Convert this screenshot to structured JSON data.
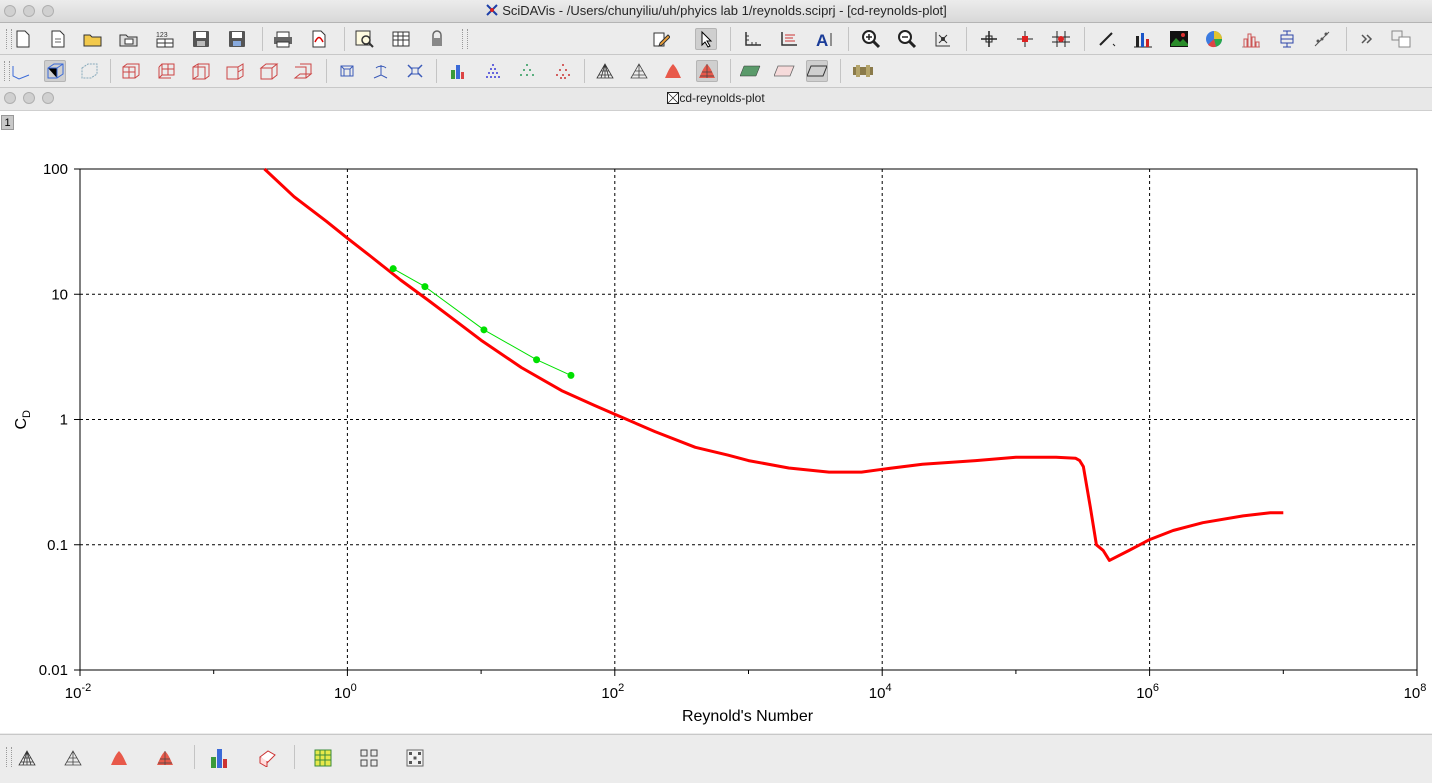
{
  "window": {
    "title": "SciDAVis - /Users/chunyiliu/uh/phyics lab 1/reynolds.sciprj - [cd-reynolds-plot]"
  },
  "subwindow": {
    "title": "cd-reynolds-plot",
    "layer_label": "1"
  },
  "toolbar1": {
    "buttons": [
      "new-project-icon",
      "new-file-icon",
      "open-folder-icon",
      "open-template-icon",
      "import-ascii-icon",
      "save-icon",
      "save-as-icon",
      "print-icon",
      "export-pdf-icon",
      "find-icon",
      "table-icon",
      "lock-icon",
      "edit-icon",
      "pointer-icon",
      "axes-icon",
      "legend-icon",
      "text-icon",
      "zoom-in-icon",
      "zoom-out-icon",
      "rescale-icon",
      "crosshair-icon",
      "data-reader-icon",
      "screen-reader-icon",
      "draw-line-icon",
      "bar-chart-icon",
      "image-icon",
      "pie-icon",
      "histogram-icon",
      "box-plot-icon",
      "fit-icon"
    ]
  },
  "toolbar2": {
    "buttons": [
      "curve-3d-icon",
      "box-3d-icon",
      "frame-3d-icon",
      "grid-front-icon",
      "grid-back-icon",
      "grid-left-icon",
      "grid-right-icon",
      "grid-ceil-icon",
      "grid-floor-icon",
      "perspective-icon",
      "rotate-icon",
      "fit-view-icon",
      "bars-3d-icon",
      "points-3d-icon",
      "cross-3d-icon",
      "cones-3d-icon",
      "wireframe-icon",
      "mesh-icon",
      "surface-icon",
      "surface-mesh-icon",
      "plane-green-icon",
      "plane-pattern-icon",
      "plane-empty-icon",
      "animation-icon"
    ]
  },
  "bottom_toolbar": {
    "buttons": [
      "wireframe-icon",
      "mesh-icon",
      "surface-icon",
      "contour-icon",
      "bars-3d-icon",
      "ribbon-icon",
      "matrix-icon",
      "grid-qr-icon",
      "grid-dots-icon"
    ]
  },
  "chart_data": {
    "type": "line",
    "xlabel": "Reynold's Number",
    "ylabel": "C",
    "ylabel_subscript": "D",
    "x_scale": "log",
    "y_scale": "log",
    "xlim": [
      0.01,
      100000000
    ],
    "ylim": [
      0.01,
      100
    ],
    "x_ticks": [
      {
        "value": 0.01,
        "base": "10",
        "exp": "-2"
      },
      {
        "value": 1,
        "base": "10",
        "exp": "0"
      },
      {
        "value": 100,
        "base": "10",
        "exp": "2"
      },
      {
        "value": 10000,
        "base": "10",
        "exp": "4"
      },
      {
        "value": 1000000,
        "base": "10",
        "exp": "6"
      },
      {
        "value": 100000000,
        "base": "10",
        "exp": "8"
      }
    ],
    "y_ticks": [
      {
        "value": 0.01,
        "label": "0.01"
      },
      {
        "value": 0.1,
        "label": "0.1"
      },
      {
        "value": 1,
        "label": "1"
      },
      {
        "value": 10,
        "label": "10"
      },
      {
        "value": 100,
        "label": "100"
      }
    ],
    "grid": true,
    "series": [
      {
        "color": "#ff0000",
        "style": "line",
        "x": [
          0.24,
          0.4,
          0.7,
          1.0,
          1.5,
          2.5,
          4,
          6,
          10,
          20,
          40,
          70,
          100,
          200,
          400,
          700,
          1000,
          2000,
          4000,
          7000,
          10000,
          20000,
          50000,
          100000,
          200000,
          280000,
          300000,
          320000,
          360000,
          400000,
          450000,
          500000,
          700000,
          1000000,
          1500000,
          2500000,
          5000000,
          8000000,
          10000000
        ],
        "y": [
          100,
          60,
          38,
          28,
          20,
          13,
          9,
          6.5,
          4.3,
          2.6,
          1.7,
          1.3,
          1.1,
          0.8,
          0.6,
          0.52,
          0.47,
          0.41,
          0.38,
          0.38,
          0.4,
          0.44,
          0.47,
          0.5,
          0.5,
          0.49,
          0.47,
          0.42,
          0.2,
          0.1,
          0.09,
          0.075,
          0.09,
          0.11,
          0.13,
          0.15,
          0.17,
          0.18,
          0.18
        ]
      },
      {
        "color": "#00e000",
        "style": "line+markers",
        "x": [
          2.2,
          3.8,
          10.5,
          26,
          47
        ],
        "y": [
          16,
          11.5,
          5.2,
          3.0,
          2.25
        ]
      }
    ]
  }
}
